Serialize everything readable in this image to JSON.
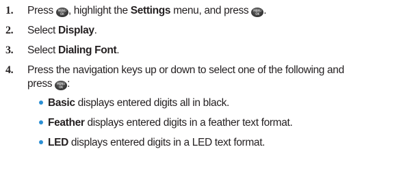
{
  "key_labels": {
    "top": "MENU",
    "bottom": "OK"
  },
  "steps": [
    {
      "number": "1.",
      "parts": {
        "a": "Press ",
        "b": ", highlight the ",
        "c": "Settings",
        "d": " menu, and press ",
        "e": "."
      }
    },
    {
      "number": "2.",
      "parts": {
        "a": "Select ",
        "b": "Display",
        "c": "."
      }
    },
    {
      "number": "3.",
      "parts": {
        "a": "Select ",
        "b": "Dialing Font",
        "c": "."
      }
    },
    {
      "number": "4.",
      "line1": "Press the navigation keys up or down to select one of the following and",
      "line2a": "press ",
      "line2b": ":"
    }
  ],
  "options": [
    {
      "term": "Basic",
      "desc": " displays entered digits all in black."
    },
    {
      "term": "Feather",
      "desc": " displays entered digits in a feather text format."
    },
    {
      "term": "LED",
      "desc": " displays entered digits in a LED text format."
    }
  ],
  "colors": {
    "bullet": "#2a8fd4",
    "text": "#231f20"
  },
  "icons": {
    "menu_ok_key": "menu-ok-key-icon",
    "bullet": "bullet-dot"
  }
}
